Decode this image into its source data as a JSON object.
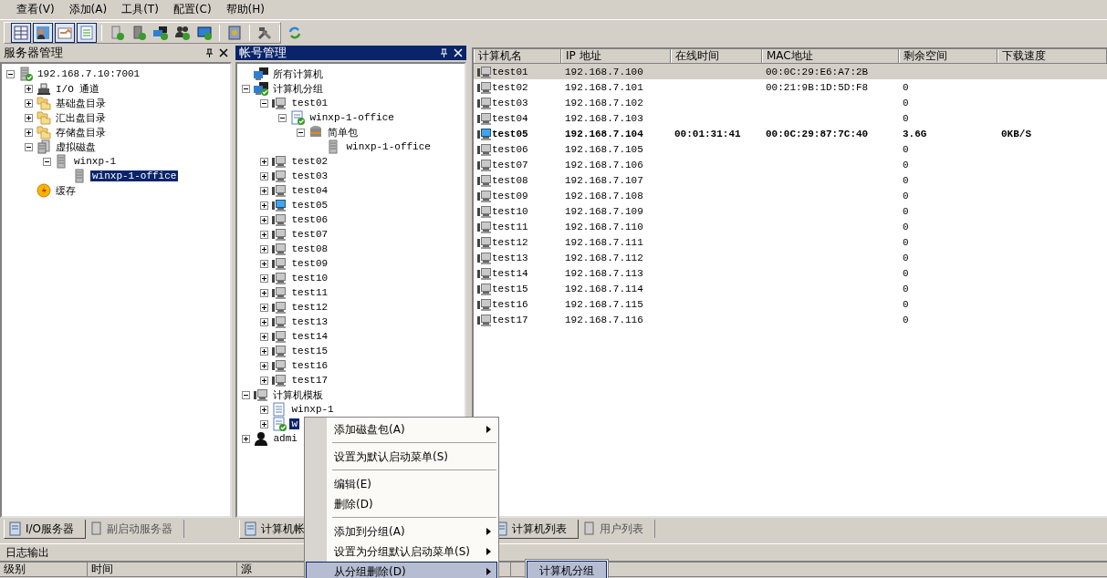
{
  "menu_bar": [
    "查看(V)",
    "添加(A)",
    "工具(T)",
    "配置(C)",
    "帮助(H)"
  ],
  "toolbar": {
    "groups": [
      [
        {
          "pressed": true
        },
        {
          "pressed": true
        },
        {
          "pressed": true
        },
        {
          "pressed": true
        }
      ],
      [
        {
          "pressed": false
        },
        {
          "pressed": false
        },
        {
          "pressed": false
        },
        {
          "pressed": false
        },
        {
          "pressed": false
        }
      ],
      [
        {
          "pressed": false
        }
      ],
      [
        {
          "pressed": false
        }
      ],
      [
        {
          "pressed": false
        }
      ]
    ]
  },
  "server_panel": {
    "title": "服务器管理",
    "active": false,
    "tree": [
      {
        "label": "192.168.7.10:7001",
        "kind": "server",
        "expanded": true,
        "selected": false,
        "children": [
          {
            "label": "I/O 通道",
            "kind": "channel",
            "expanded": false,
            "selected": false
          },
          {
            "label": "基础盘目录",
            "kind": "folder",
            "expanded": false,
            "selected": false
          },
          {
            "label": "汇出盘目录",
            "kind": "folder",
            "expanded": false,
            "selected": false
          },
          {
            "label": "存储盘目录",
            "kind": "folder",
            "expanded": false,
            "selected": false
          },
          {
            "label": "虚拟磁盘",
            "kind": "disks",
            "expanded": true,
            "selected": false,
            "children": [
              {
                "label": "winxp-1",
                "kind": "disk",
                "expanded": true,
                "selected": false,
                "children": [
                  {
                    "label": "winxp-1-office",
                    "kind": "disk",
                    "selected": true
                  }
                ]
              }
            ]
          },
          {
            "label": "缓存",
            "kind": "cache",
            "selected": false
          }
        ]
      }
    ],
    "tabs": [
      {
        "label": "I/O服务器",
        "selected": true
      },
      {
        "label": "副启动服务器",
        "selected": false
      }
    ]
  },
  "account_panel": {
    "title": "帐号管理",
    "active": true,
    "tree": [
      {
        "label": "所有计算机",
        "kind": "pcs",
        "selected": false
      },
      {
        "label": "计算机分组",
        "kind": "pcs-ok",
        "expanded": true,
        "selected": false,
        "children": [
          {
            "label": "test01",
            "kind": "pc",
            "expanded": true,
            "selected": false,
            "children": [
              {
                "label": "winxp-1-office",
                "kind": "doc-ok",
                "expanded": true,
                "selected": false,
                "children": [
                  {
                    "label": "简单包",
                    "kind": "package",
                    "expanded": true,
                    "selected": false,
                    "children": [
                      {
                        "label": "winxp-1-office",
                        "kind": "disk",
                        "selected": false
                      }
                    ]
                  }
                ]
              }
            ]
          },
          {
            "label": "test02",
            "kind": "pc",
            "expanded": false,
            "selected": false
          },
          {
            "label": "test03",
            "kind": "pc",
            "expanded": false,
            "selected": false
          },
          {
            "label": "test04",
            "kind": "pc",
            "expanded": false,
            "selected": false
          },
          {
            "label": "test05",
            "kind": "pc-online",
            "expanded": false,
            "selected": false
          },
          {
            "label": "test06",
            "kind": "pc",
            "expanded": false,
            "selected": false
          },
          {
            "label": "test07",
            "kind": "pc",
            "expanded": false,
            "selected": false
          },
          {
            "label": "test08",
            "kind": "pc",
            "expanded": false,
            "selected": false
          },
          {
            "label": "test09",
            "kind": "pc",
            "expanded": false,
            "selected": false
          },
          {
            "label": "test10",
            "kind": "pc",
            "expanded": false,
            "selected": false
          },
          {
            "label": "test11",
            "kind": "pc",
            "expanded": false,
            "selected": false
          },
          {
            "label": "test12",
            "kind": "pc",
            "expanded": false,
            "selected": false
          },
          {
            "label": "test13",
            "kind": "pc",
            "expanded": false,
            "selected": false
          },
          {
            "label": "test14",
            "kind": "pc",
            "expanded": false,
            "selected": false
          },
          {
            "label": "test15",
            "kind": "pc",
            "expanded": false,
            "selected": false
          },
          {
            "label": "test16",
            "kind": "pc",
            "expanded": false,
            "selected": false
          },
          {
            "label": "test17",
            "kind": "pc",
            "expanded": false,
            "selected": false
          }
        ]
      },
      {
        "label": "计算机模板",
        "kind": "pc",
        "expanded": true,
        "selected": false,
        "children": [
          {
            "label": "winxp-1",
            "kind": "doc",
            "expanded": false,
            "selected": false
          },
          {
            "label": "w",
            "kind": "doc-ok",
            "expanded": false,
            "selected": true
          }
        ]
      },
      {
        "label": "admi",
        "kind": "user",
        "expanded": false,
        "selected": false
      }
    ],
    "tabs": [
      {
        "label": "计算机帐",
        "selected": true
      }
    ]
  },
  "computer_list": {
    "columns": [
      "计算机名",
      "IP 地址",
      "在线时间",
      "MAC地址",
      "剩余空间",
      "下载速度"
    ],
    "rows": [
      {
        "cells": [
          "test01",
          "192.168.7.100",
          "",
          "00:0C:29:E6:A7:2B",
          "",
          ""
        ],
        "online": false,
        "selected": true
      },
      {
        "cells": [
          "test02",
          "192.168.7.101",
          "",
          "00:21:9B:1D:5D:F8",
          "0",
          ""
        ],
        "online": false,
        "selected": false
      },
      {
        "cells": [
          "test03",
          "192.168.7.102",
          "",
          "",
          "0",
          ""
        ],
        "online": false,
        "selected": false
      },
      {
        "cells": [
          "test04",
          "192.168.7.103",
          "",
          "",
          "0",
          ""
        ],
        "online": false,
        "selected": false
      },
      {
        "cells": [
          "test05",
          "192.168.7.104",
          "00:01:31:41",
          "00:0C:29:87:7C:40",
          "3.6G",
          "0KB/S"
        ],
        "online": true,
        "selected": false
      },
      {
        "cells": [
          "test06",
          "192.168.7.105",
          "",
          "",
          "0",
          ""
        ],
        "online": false,
        "selected": false
      },
      {
        "cells": [
          "test07",
          "192.168.7.106",
          "",
          "",
          "0",
          ""
        ],
        "online": false,
        "selected": false
      },
      {
        "cells": [
          "test08",
          "192.168.7.107",
          "",
          "",
          "0",
          ""
        ],
        "online": false,
        "selected": false
      },
      {
        "cells": [
          "test09",
          "192.168.7.108",
          "",
          "",
          "0",
          ""
        ],
        "online": false,
        "selected": false
      },
      {
        "cells": [
          "test10",
          "192.168.7.109",
          "",
          "",
          "0",
          ""
        ],
        "online": false,
        "selected": false
      },
      {
        "cells": [
          "test11",
          "192.168.7.110",
          "",
          "",
          "0",
          ""
        ],
        "online": false,
        "selected": false
      },
      {
        "cells": [
          "test12",
          "192.168.7.111",
          "",
          "",
          "0",
          ""
        ],
        "online": false,
        "selected": false
      },
      {
        "cells": [
          "test13",
          "192.168.7.112",
          "",
          "",
          "0",
          ""
        ],
        "online": false,
        "selected": false
      },
      {
        "cells": [
          "test14",
          "192.168.7.113",
          "",
          "",
          "0",
          ""
        ],
        "online": false,
        "selected": false
      },
      {
        "cells": [
          "test15",
          "192.168.7.114",
          "",
          "",
          "0",
          ""
        ],
        "online": false,
        "selected": false
      },
      {
        "cells": [
          "test16",
          "192.168.7.115",
          "",
          "",
          "0",
          ""
        ],
        "online": false,
        "selected": false
      },
      {
        "cells": [
          "test17",
          "192.168.7.116",
          "",
          "",
          "0",
          ""
        ],
        "online": false,
        "selected": false
      }
    ],
    "tabs": [
      {
        "label": "计算机列表",
        "selected": true
      },
      {
        "label": "用户列表",
        "selected": false
      }
    ]
  },
  "log_panel": {
    "title": "日志输出",
    "columns": [
      "级别",
      "时间",
      "源"
    ]
  },
  "context_menu": {
    "items": [
      {
        "kind": "item",
        "label": "添加磁盘包(A)",
        "submenu": true,
        "selected": false
      },
      {
        "kind": "separator"
      },
      {
        "kind": "item",
        "label": "设置为默认启动菜单(S)",
        "submenu": false,
        "selected": false
      },
      {
        "kind": "separator"
      },
      {
        "kind": "item",
        "label": "编辑(E)",
        "submenu": false,
        "selected": false
      },
      {
        "kind": "item",
        "label": "删除(D)",
        "submenu": false,
        "selected": false
      },
      {
        "kind": "separator"
      },
      {
        "kind": "item",
        "label": "添加到分组(A)",
        "submenu": true,
        "selected": false
      },
      {
        "kind": "item",
        "label": "设置为分组默认启动菜单(S)",
        "submenu": true,
        "selected": false
      },
      {
        "kind": "item",
        "label": "从分组删除(D)",
        "submenu": true,
        "selected": true
      }
    ],
    "submenu": {
      "items": [
        {
          "label": "计算机分组",
          "selected": true
        }
      ]
    }
  }
}
